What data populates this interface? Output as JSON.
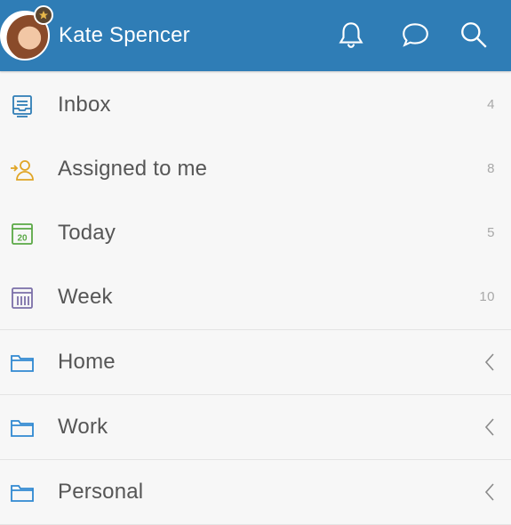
{
  "header": {
    "user_name": "Kate Spencer",
    "actions": [
      {
        "icon": "bell-icon"
      },
      {
        "icon": "chat-bubble-icon"
      },
      {
        "icon": "search-icon"
      }
    ]
  },
  "colors": {
    "header_bg": "#2f7db6",
    "inbox": "#2f7db6",
    "assigned": "#e0a526",
    "today": "#5aa845",
    "week": "#7b6fa8",
    "folder": "#2f88d1"
  },
  "smart_lists": [
    {
      "label": "Inbox",
      "count": "4",
      "icon": "inbox-icon"
    },
    {
      "label": "Assigned to me",
      "count": "8",
      "icon": "assigned-user-icon"
    },
    {
      "label": "Today",
      "count": "5",
      "icon": "calendar-today-icon",
      "icon_text": "20"
    },
    {
      "label": "Week",
      "count": "10",
      "icon": "calendar-week-icon"
    }
  ],
  "folders": [
    {
      "label": "Home",
      "icon": "folder-icon"
    },
    {
      "label": "Work",
      "icon": "folder-icon"
    },
    {
      "label": "Personal",
      "icon": "folder-icon"
    }
  ]
}
